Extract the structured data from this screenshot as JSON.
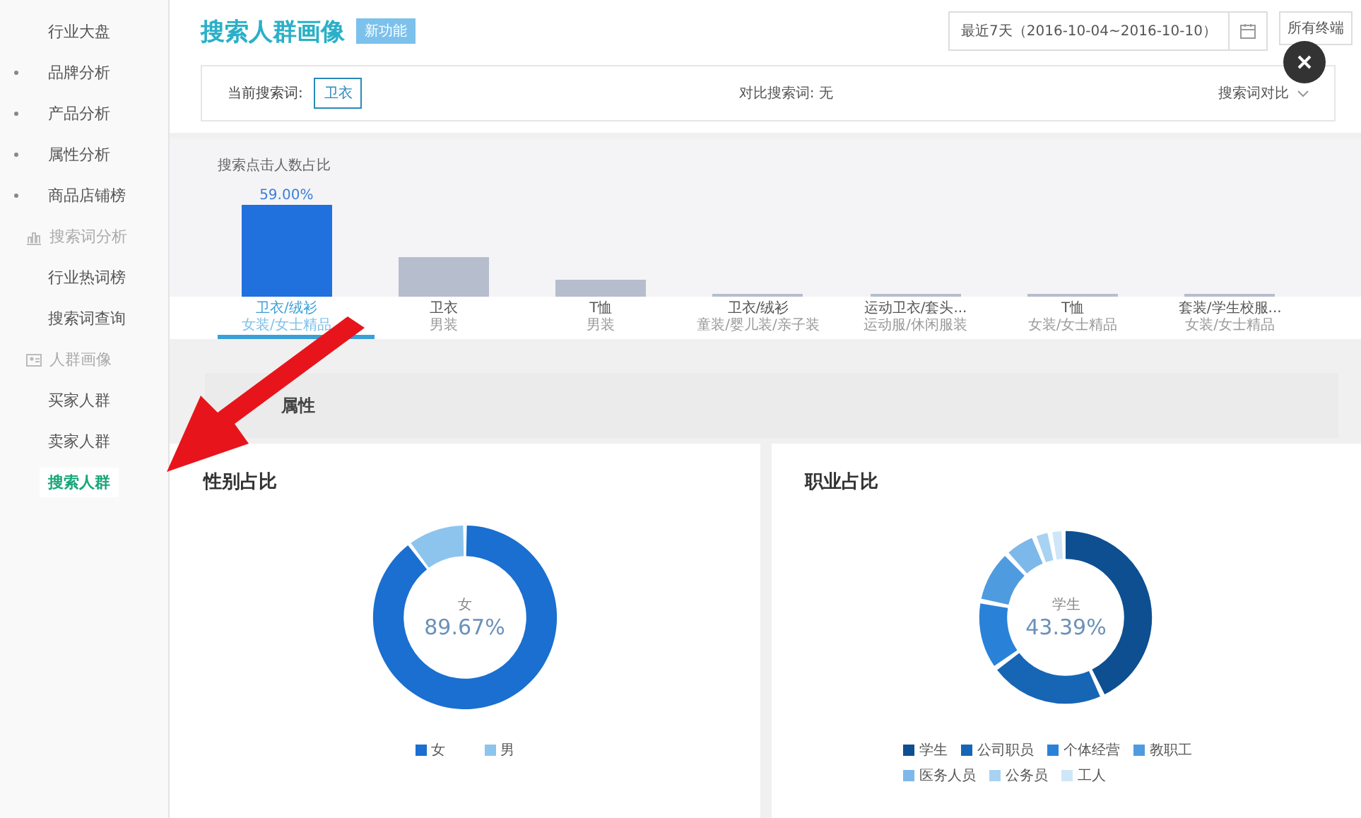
{
  "sidebar": {
    "items": [
      {
        "kind": "link",
        "label": "行业大盘",
        "selected": false
      },
      {
        "kind": "group",
        "label": "品牌分析",
        "selected": false
      },
      {
        "kind": "group",
        "label": "产品分析",
        "selected": false
      },
      {
        "kind": "group",
        "label": "属性分析",
        "selected": false
      },
      {
        "kind": "group",
        "label": "商品店铺榜",
        "selected": false
      },
      {
        "kind": "section",
        "label": "搜索词分析"
      },
      {
        "kind": "link",
        "label": "行业热词榜",
        "selected": false
      },
      {
        "kind": "link",
        "label": "搜索词查询",
        "selected": false
      },
      {
        "kind": "section",
        "label": "人群画像"
      },
      {
        "kind": "link",
        "label": "买家人群",
        "selected": false
      },
      {
        "kind": "link",
        "label": "卖家人群",
        "selected": false
      },
      {
        "kind": "link",
        "label": "搜索人群",
        "selected": true
      }
    ]
  },
  "header": {
    "title": "搜索人群画像",
    "badge": "新功能",
    "date_range": "最近7天（2016-10-04~2016-10-10）",
    "terminal": "所有终端"
  },
  "search_bar": {
    "current_label": "当前搜索词:",
    "current_term": "卫衣",
    "compare_label": "对比搜索词: 无",
    "compare_button": "搜索词对比"
  },
  "click_share": {
    "title": "搜索点击人数占比",
    "top_value": "59.00%",
    "categories": [
      {
        "name": "卫衣/绒衫",
        "sub": "女装/女士精品",
        "selected": true
      },
      {
        "name": "卫衣",
        "sub": "男装",
        "selected": false
      },
      {
        "name": "T恤",
        "sub": "男装",
        "selected": false
      },
      {
        "name": "卫衣/绒衫",
        "sub": "童装/婴儿装/亲子装",
        "selected": false
      },
      {
        "name": "运动卫衣/套头...",
        "sub": "运动服/休闲服装",
        "selected": false
      },
      {
        "name": "T恤",
        "sub": "女装/女士精品",
        "selected": false
      },
      {
        "name": "套装/学生校服...",
        "sub": "女装/女士精品",
        "selected": false
      }
    ]
  },
  "section_title": "属性",
  "gender": {
    "center_label": "女",
    "center_value": "89.67%",
    "chart_data": {
      "type": "donut",
      "title": "性别占比",
      "categories": [
        "女",
        "男"
      ],
      "values": [
        89.67,
        10.33
      ]
    },
    "legend": [
      {
        "color": "#1a6fd0"
      },
      {
        "color": "#8cc4ee"
      }
    ]
  },
  "occupation": {
    "title": "职业占比",
    "center_label": "学生",
    "center_value": "43.39%",
    "legend": [
      {
        "label": "学生",
        "color": "#0d4f91"
      },
      {
        "label": "公司职员",
        "color": "#1765b5"
      },
      {
        "label": "个体经营",
        "color": "#2a82d8"
      },
      {
        "label": "教职工",
        "color": "#4f9be0"
      },
      {
        "label": "医务人员",
        "color": "#7db8ea"
      },
      {
        "label": "公务员",
        "color": "#a8d2f2"
      },
      {
        "label": "工人",
        "color": "#cfe6f8"
      }
    ]
  }
}
